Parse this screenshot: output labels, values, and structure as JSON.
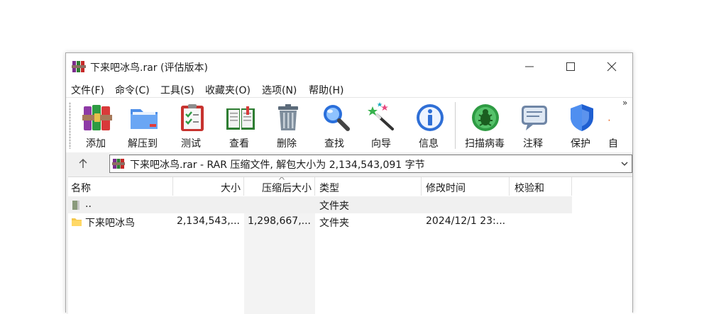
{
  "window": {
    "title": "下来吧冰鸟.rar (评估版本)",
    "caption": {
      "minimize": "minimize",
      "maximize": "maximize",
      "close": "close"
    }
  },
  "menu": [
    "文件(F)",
    "命令(C)",
    "工具(S)",
    "收藏夹(O)",
    "选项(N)",
    "帮助(H)"
  ],
  "toolbar": {
    "buttons": [
      {
        "label": "添加",
        "icon": "books-add-icon"
      },
      {
        "label": "解压到",
        "icon": "folder-extract-icon"
      },
      {
        "label": "测试",
        "icon": "clipboard-check-icon"
      },
      {
        "label": "查看",
        "icon": "open-book-icon"
      },
      {
        "label": "删除",
        "icon": "trash-icon"
      },
      {
        "label": "查找",
        "icon": "magnifier-icon"
      },
      {
        "label": "向导",
        "icon": "magic-wand-icon"
      },
      {
        "label": "信息",
        "icon": "info-icon"
      },
      {
        "label": "扫描病毒",
        "icon": "virus-scan-icon"
      },
      {
        "label": "注释",
        "icon": "comment-icon"
      },
      {
        "label": "保护",
        "icon": "shield-icon"
      },
      {
        "label": "自",
        "icon": "sfx-icon"
      }
    ],
    "more": "»"
  },
  "address": {
    "text": "下来吧冰鸟.rar - RAR 压缩文件, 解包大小为 2,134,543,091 字节"
  },
  "columns": [
    "名称",
    "大小",
    "压缩后大小",
    "类型",
    "修改时间",
    "校验和"
  ],
  "rows": [
    {
      "name": "..",
      "size": "",
      "packed": "",
      "type": "文件夹",
      "modified": "",
      "crc": ""
    },
    {
      "name": "下来吧冰鸟",
      "size": "2,134,543,...",
      "packed": "1,298,667,...",
      "type": "文件夹",
      "modified": "2024/12/1 23:...",
      "crc": ""
    }
  ],
  "colors": {
    "accent": "#1a73e8",
    "folder": "#f5c84c",
    "selected_row": "#f0f0f0"
  }
}
